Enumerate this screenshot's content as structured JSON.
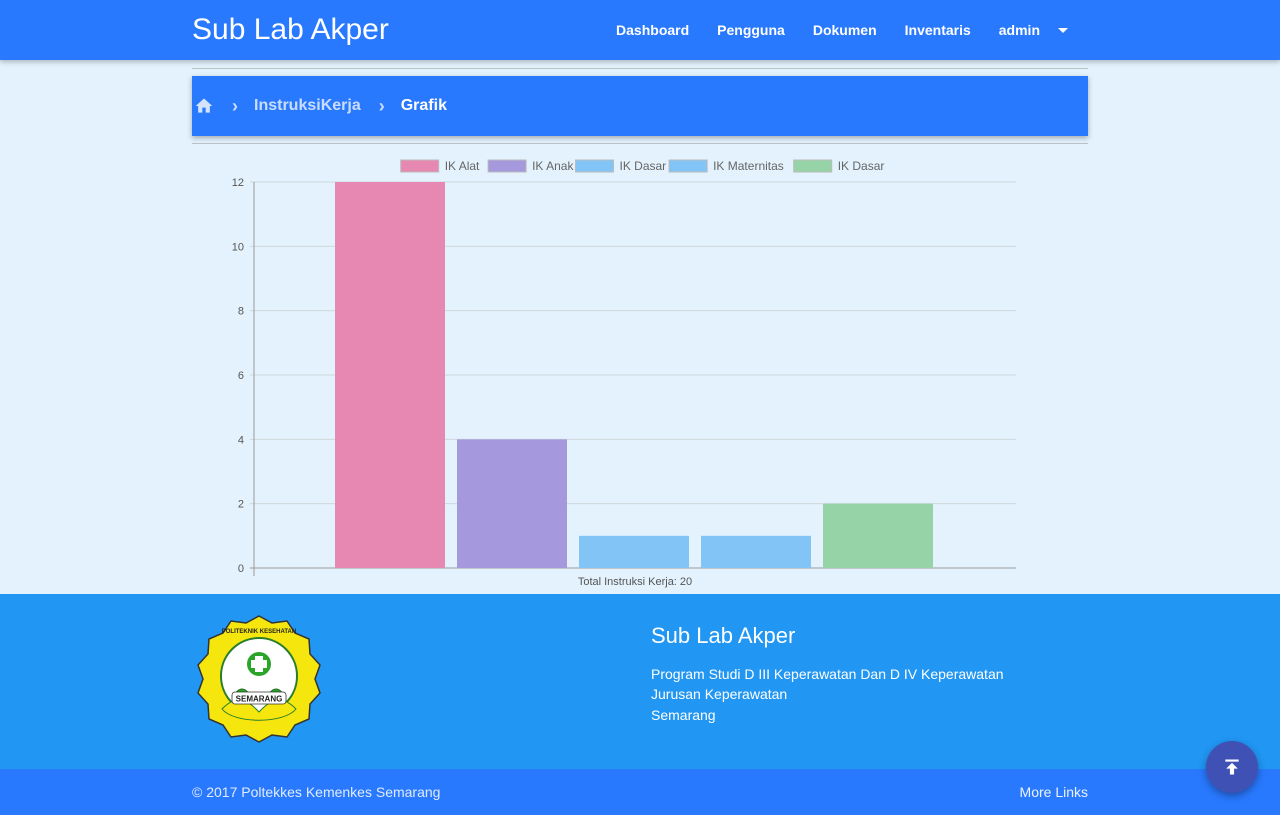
{
  "navbar": {
    "brand": "Sub Lab Akper",
    "items": [
      {
        "label": "Dashboard"
      },
      {
        "label": "Pengguna"
      },
      {
        "label": "Dokumen"
      },
      {
        "label": "Inventaris"
      }
    ],
    "user_menu": "admin",
    "icons": {
      "user_menu": "caret-down-icon"
    }
  },
  "breadcrumb": {
    "home_icon": "home-icon",
    "separator_icon": "chevron-right-icon",
    "link": "InstruksiKerja",
    "current": "Grafik"
  },
  "chart_data": {
    "type": "bar",
    "legend_position": "top",
    "grid": true,
    "xlabel": "Total Instruksi Kerja: 20",
    "ylim": [
      0,
      12
    ],
    "y_ticks": [
      0,
      2,
      4,
      6,
      8,
      10,
      12
    ],
    "series": [
      {
        "name": "IK Alat",
        "value": 12,
        "color": "#e788b2"
      },
      {
        "name": "IK Anak",
        "value": 4,
        "color": "#a698dc"
      },
      {
        "name": "IK Dasar",
        "value": 1,
        "color": "#82c4f6"
      },
      {
        "name": "IK Maternitas",
        "value": 1,
        "color": "#82c4f6"
      },
      {
        "name": "IK Dasar",
        "value": 2,
        "color": "#96d3a6"
      }
    ]
  },
  "footer": {
    "logo_text_top": "POLITEKNIK KESEHATAN",
    "logo_text_bottom": "SEMARANG",
    "title": "Sub Lab Akper",
    "lines": [
      "Program Studi D III Keperawatan Dan D IV Keperawatan",
      "Jurusan Keperawatan",
      "Semarang"
    ],
    "copyright": "© 2017 Poltekkes Kemenkes Semarang",
    "more_links": "More Links"
  },
  "fab": {
    "icon": "arrow-to-top-icon"
  },
  "colors": {
    "primary": "#2979ff",
    "footer": "#2196f3",
    "background": "#e3f2fd",
    "fab": "#3f51b5"
  }
}
